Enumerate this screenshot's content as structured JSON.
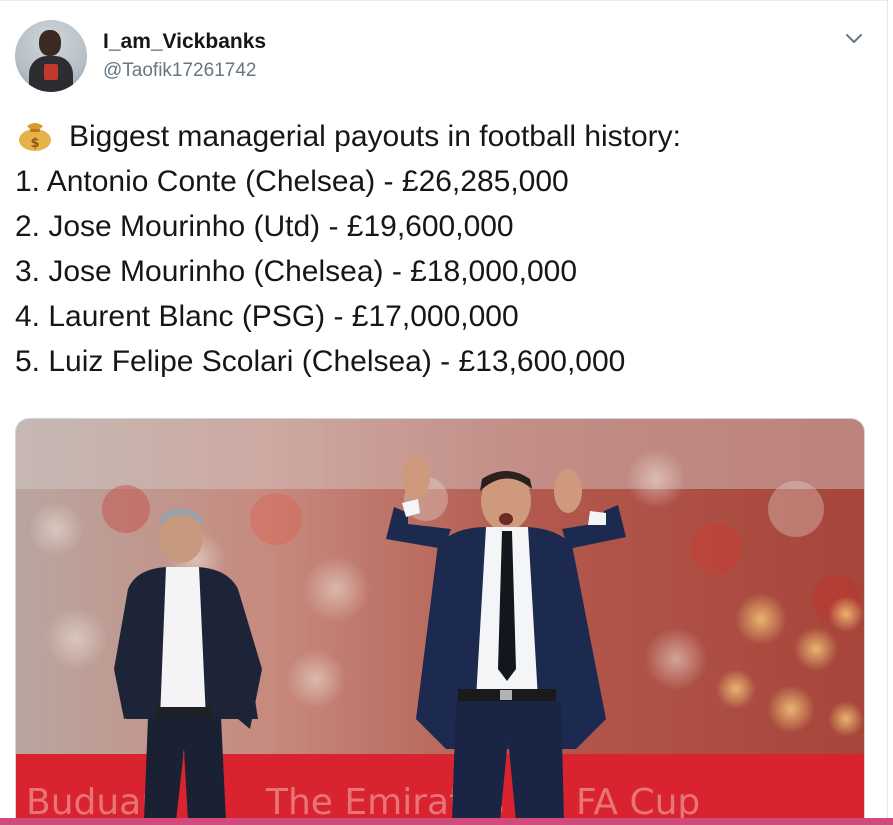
{
  "user": {
    "display_name": "I_am_Vickbanks",
    "handle": "@Taofik17261742"
  },
  "tweet": {
    "emoji": "money-bag-icon",
    "headline": "Biggest managerial payouts in football history:",
    "list": [
      "1. Antonio Conte (Chelsea) - £26,285,000",
      "2. Jose Mourinho (Utd) - £19,600,000",
      "3. Jose Mourinho (Chelsea) - £18,000,000",
      "4. Laurent Blanc (PSG) - £17,000,000",
      "5. Luiz Felipe Scolari (Chelsea) - £13,600,000"
    ]
  },
  "media": {
    "banner_text": "The Emirates FA Cup"
  },
  "colors": {
    "text": "#14171a",
    "secondary_text": "#657786",
    "caret": "#657786",
    "accent_bar": "#d04a7c",
    "banner_red": "#d9232f"
  }
}
